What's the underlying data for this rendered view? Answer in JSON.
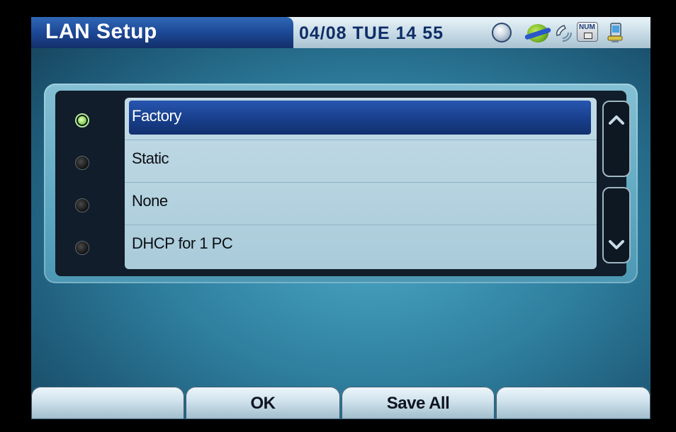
{
  "header": {
    "title": "LAN Setup",
    "datetime": "04/08 TUE 14 55",
    "status_icons": [
      "globe-icon",
      "network-globe-icon",
      "phone-ring-icon",
      "num-lock-icon",
      "pc-icon"
    ],
    "num_label": "NUM"
  },
  "options": [
    {
      "label": "Factory",
      "selected": true
    },
    {
      "label": "Static",
      "selected": false
    },
    {
      "label": "None",
      "selected": false
    },
    {
      "label": "DHCP for 1 PC",
      "selected": false
    }
  ],
  "softkeys": [
    "",
    "OK",
    "Save All",
    ""
  ],
  "colors": {
    "title_bg": "#1d4896",
    "selection": "#173d88",
    "panel": "#5fa8c2",
    "radio_selected": "#8ad45c"
  }
}
